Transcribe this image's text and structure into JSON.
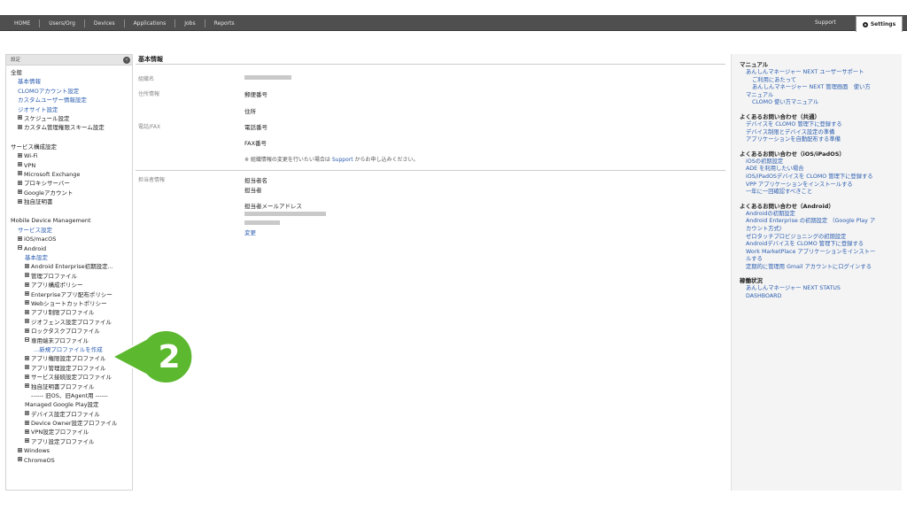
{
  "nav": {
    "items": [
      "HOME",
      "Users/Org",
      "Devices",
      "Applications",
      "Jobs",
      "Reports"
    ],
    "support": "Support",
    "settings": "Settings"
  },
  "sidebar": {
    "header": "設定",
    "lines": [
      {
        "text": "全般",
        "kind": "h",
        "indent": 0
      },
      {
        "text": "基本情報",
        "kind": "link",
        "indent": 2
      },
      {
        "text": "CLOMOアカウント設定",
        "kind": "link",
        "indent": 2
      },
      {
        "text": "カスタムユーザー情報設定",
        "kind": "link",
        "indent": 2
      },
      {
        "text": "ジオサイト設定",
        "kind": "link",
        "indent": 2
      },
      {
        "text": "スケジュール設定",
        "kind": "node",
        "indent": 2,
        "exp": "plus"
      },
      {
        "text": "カスタム管理権限スキーム設定",
        "kind": "node",
        "indent": 2,
        "exp": "plus"
      },
      {
        "text": "",
        "kind": "gap"
      },
      {
        "text": "サービス構成設定",
        "kind": "h",
        "indent": 0
      },
      {
        "text": "Wi-Fi",
        "kind": "node",
        "indent": 2,
        "exp": "plus"
      },
      {
        "text": "VPN",
        "kind": "node",
        "indent": 2,
        "exp": "plus"
      },
      {
        "text": "Microsoft Exchange",
        "kind": "node",
        "indent": 2,
        "exp": "plus"
      },
      {
        "text": "プロキシサーバー",
        "kind": "node",
        "indent": 2,
        "exp": "plus"
      },
      {
        "text": "Googleアカウント",
        "kind": "node",
        "indent": 2,
        "exp": "plus"
      },
      {
        "text": "独自証明書",
        "kind": "node",
        "indent": 2,
        "exp": "plus"
      },
      {
        "text": "",
        "kind": "gap"
      },
      {
        "text": "Mobile Device Management",
        "kind": "h",
        "indent": 0
      },
      {
        "text": "サービス設定",
        "kind": "link",
        "indent": 2
      },
      {
        "text": "iOS/macOS",
        "kind": "node",
        "indent": 2,
        "exp": "plus"
      },
      {
        "text": "Android",
        "kind": "node",
        "indent": 2,
        "exp": "minus"
      },
      {
        "text": "基本設定",
        "kind": "link",
        "indent": 3
      },
      {
        "text": "Android Enterprise初期設定...",
        "kind": "node",
        "indent": 3,
        "exp": "plus"
      },
      {
        "text": "管理プロファイル",
        "kind": "node",
        "indent": 3,
        "exp": "plus"
      },
      {
        "text": "アプリ構成ポリシー",
        "kind": "node",
        "indent": 3,
        "exp": "plus"
      },
      {
        "text": "Enterpriseアプリ配布ポリシー",
        "kind": "node",
        "indent": 3,
        "exp": "plus"
      },
      {
        "text": "Webショートカットポリシー",
        "kind": "node",
        "indent": 3,
        "exp": "plus"
      },
      {
        "text": "アプリ制限プロファイル",
        "kind": "node",
        "indent": 3,
        "exp": "plus"
      },
      {
        "text": "ジオフェンス設定プロファイル",
        "kind": "node",
        "indent": 3,
        "exp": "plus"
      },
      {
        "text": "ロックタスクプロファイル",
        "kind": "node",
        "indent": 3,
        "exp": "plus"
      },
      {
        "text": "専用端末プロファイル",
        "kind": "node",
        "indent": 3,
        "exp": "minus"
      },
      {
        "text": "...新規プロファイルを作成",
        "kind": "link",
        "indent": 5
      },
      {
        "text": "アプリ権限設定プロファイル",
        "kind": "node",
        "indent": 3,
        "exp": "plus"
      },
      {
        "text": "アプリ管理設定プロファイル",
        "kind": "node",
        "indent": 3,
        "exp": "plus"
      },
      {
        "text": "サービス接続設定プロファイル",
        "kind": "node",
        "indent": 3,
        "exp": "plus"
      },
      {
        "text": "独自証明書プロファイル",
        "kind": "node",
        "indent": 3,
        "exp": "plus"
      },
      {
        "text": "------ 旧OS、旧Agent用 ------",
        "kind": "h",
        "indent": 4
      },
      {
        "text": "Managed Google Play設定",
        "kind": "h",
        "indent": 3
      },
      {
        "text": "デバイス設定プロファイル",
        "kind": "node",
        "indent": 3,
        "exp": "plus"
      },
      {
        "text": "Device Owner設定プロファイル",
        "kind": "node",
        "indent": 3,
        "exp": "plus"
      },
      {
        "text": "VPN設定プロファイル",
        "kind": "node",
        "indent": 3,
        "exp": "plus"
      },
      {
        "text": "アプリ設定プロファイル",
        "kind": "node",
        "indent": 3,
        "exp": "plus"
      },
      {
        "text": "Windows",
        "kind": "node",
        "indent": 2,
        "exp": "plus"
      },
      {
        "text": "ChromeOS",
        "kind": "node",
        "indent": 2,
        "exp": "plus"
      }
    ]
  },
  "main": {
    "title": "基本情報",
    "org_name_label": "組織名",
    "address_label": "住所情報",
    "postal_label": "郵便番号",
    "address_field_label": "住所",
    "phone_label": "電話/FAX",
    "tel_label": "電話番号",
    "fax_label": "FAX番号",
    "note_prefix": "※ 組織情報の変更を行いたい場合は",
    "note_link": "Support",
    "note_suffix": "からお申し込みください。",
    "contact_label": "担当者情報",
    "contact_name_label": "担当者名",
    "contact_person_label": "担当者",
    "contact_email_label": "担当者メールアドレス",
    "change_link": "変更"
  },
  "right": {
    "sections": [
      {
        "heading": "マニュアル",
        "links": [
          {
            "text": "あんしんマネージャー NEXT ユーザーサポート",
            "sub": false
          },
          {
            "text": "ご利用にあたって",
            "sub": true
          },
          {
            "text": "あんしんマネージャー NEXT 管理画面　使い方",
            "sub": true
          },
          {
            "text": "マニュアル",
            "sub": false
          },
          {
            "text": "CLOMO 使い方マニュアル",
            "sub": true
          }
        ]
      },
      {
        "heading": "よくあるお問い合わせ（共通）",
        "links": [
          {
            "text": "デバイスを CLOMO 管理下に登録する",
            "sub": false
          },
          {
            "text": "デバイス制限とデバイス設定の準備",
            "sub": false
          },
          {
            "text": "アプリケーションを自動配布する準備",
            "sub": false
          }
        ]
      },
      {
        "heading": "よくあるお問い合わせ（iOS/iPadOS）",
        "links": [
          {
            "text": "iOSの初期設定",
            "sub": false
          },
          {
            "text": "ADE を利用したい場合",
            "sub": false
          },
          {
            "text": "iOS/iPadOSデバイスを CLOMO 管理下に登録する",
            "sub": false
          },
          {
            "text": "VPP アプリケーションをインストールする",
            "sub": false
          },
          {
            "text": "一年に一回確認すべきこと",
            "sub": false
          }
        ]
      },
      {
        "heading": "よくあるお問い合わせ（Android）",
        "links": [
          {
            "text": "Androidの初期設定",
            "sub": false
          },
          {
            "text": "Android Enterprise の初期設定 （Google Play ア",
            "sub": false
          },
          {
            "text": "カウント方式)",
            "sub": false
          },
          {
            "text": "ゼロタッチプロビジョニングの初期設定",
            "sub": false
          },
          {
            "text": "Androidデバイスを CLOMO 管理下に登録する",
            "sub": false
          },
          {
            "text": "Work MarketPlace アプリケーションをインストー",
            "sub": false
          },
          {
            "text": "ルする",
            "sub": false
          },
          {
            "text": "定期的に管理用 Gmail アカウントにログインする",
            "sub": false
          }
        ]
      },
      {
        "heading": "稼働状況",
        "links": [
          {
            "text": "あんしんマネージャー NEXT STATUS",
            "sub": false
          },
          {
            "text": "DASHBOARD",
            "sub": false
          }
        ]
      }
    ]
  },
  "badge": {
    "number": "2",
    "color": "#5cb82e"
  }
}
